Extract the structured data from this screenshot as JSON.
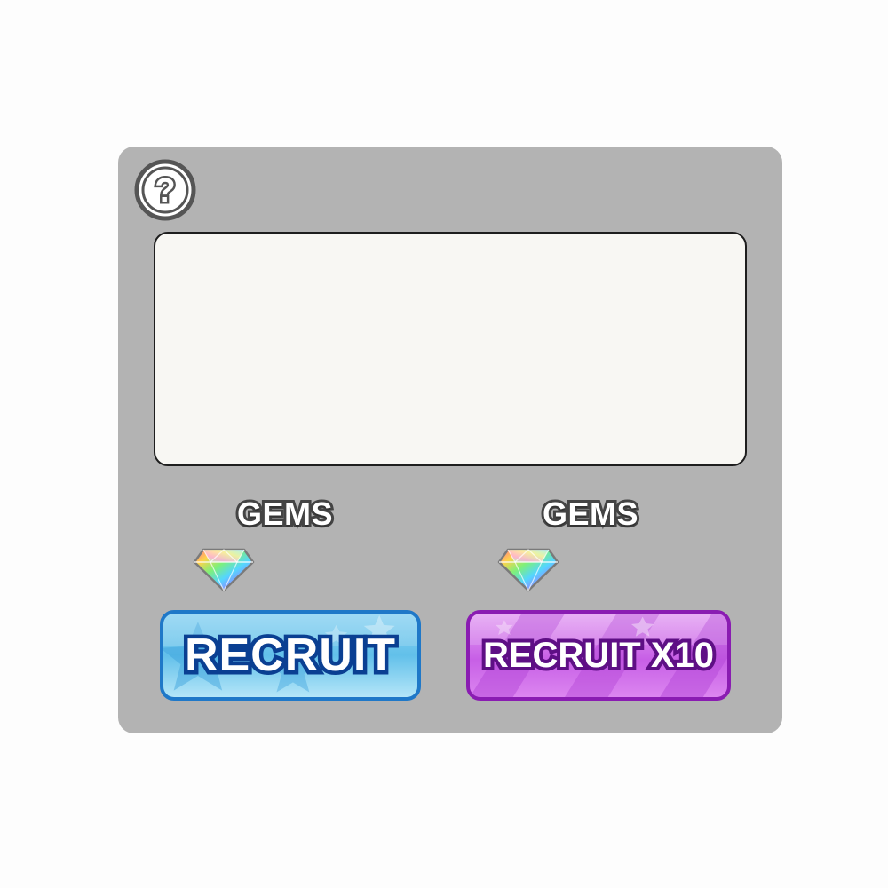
{
  "panel": {
    "help_icon": "question-mark-circle-icon",
    "content_box_text": ""
  },
  "offers": [
    {
      "currency_label": "GEMS",
      "currency_icon": "rainbow-gem-icon",
      "button_label": "RECRUIT",
      "button_color": "#1f78c8"
    },
    {
      "currency_label": "GEMS",
      "currency_icon": "rainbow-gem-icon",
      "button_label": "RECRUIT X10",
      "button_color": "#8a1cb2"
    }
  ],
  "colors": {
    "panel_bg": "#b3b3b3",
    "content_bg": "#f8f7f3",
    "recruit_blue": "#62c0ea",
    "recruit10_purple": "#c75fe6"
  }
}
